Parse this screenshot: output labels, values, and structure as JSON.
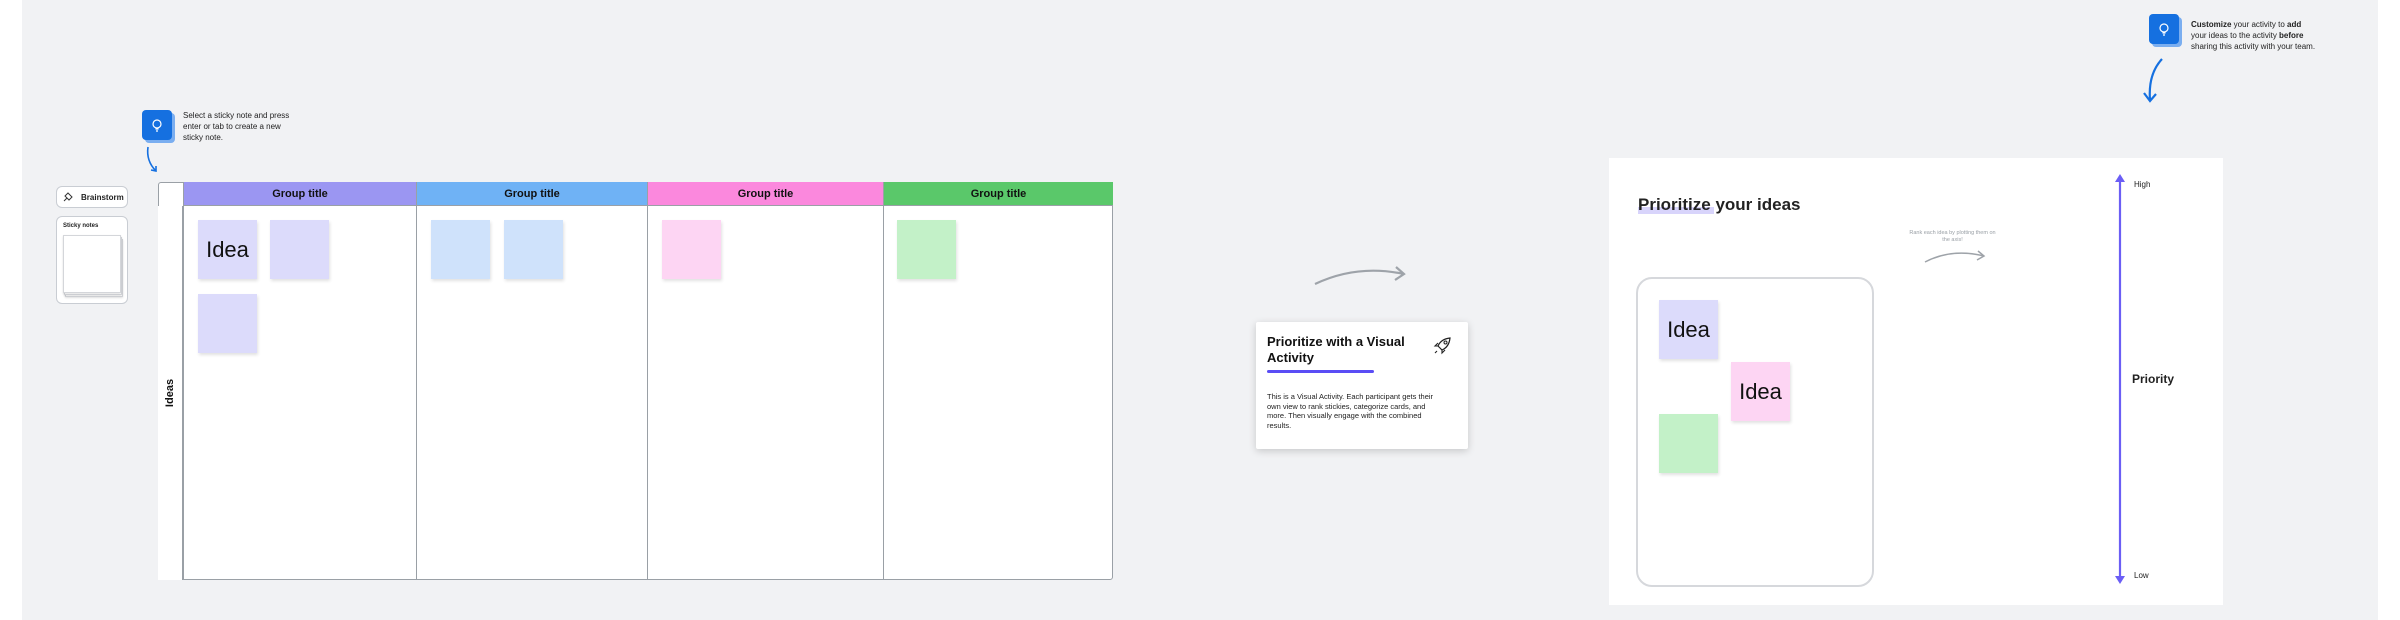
{
  "toolbar": {
    "brainstorm_label": "Brainstorm",
    "sticky_notes_label": "Sticky notes"
  },
  "hints": {
    "select_sticky": "Select a sticky note and press enter or tab to create a new sticky note.",
    "customize_bold1": "Customize",
    "customize_mid1": " your activity to ",
    "customize_bold2": "add",
    "customize_mid2": " your ideas to the activity ",
    "customize_bold3": "before",
    "customize_mid3": " sharing this activity with your team."
  },
  "table": {
    "row_label": "Ideas",
    "columns": [
      {
        "title": "Group title",
        "color": "#9b96f2"
      },
      {
        "title": "Group title",
        "color": "#6fb2f5"
      },
      {
        "title": "Group title",
        "color": "#fb88dd"
      },
      {
        "title": "Group title",
        "color": "#5ac86a"
      }
    ],
    "first_sticky_text": "Idea"
  },
  "card": {
    "title": "Prioritize with a Visual Activity",
    "body": "This is a Visual Activity. Each participant gets their own view to rank stickies, categorize cards, and more. Then visually engage with the combined results.",
    "icon": "rocket-icon"
  },
  "prioritize": {
    "title": "Prioritize your ideas",
    "note": "Rank each idea by plotting them on the axis!",
    "sticky1": "Idea",
    "sticky2": "Idea",
    "axis_high": "High",
    "axis_low": "Low",
    "axis_name": "Priority"
  },
  "colors": {
    "purple_sticky": "#dcdbfb",
    "blue_sticky": "#cfe2fb",
    "pink_sticky": "#fdd5f3",
    "green_sticky": "#c3f1c8",
    "axis": "#6b5ef5",
    "hint_blue": "#1570e0"
  }
}
